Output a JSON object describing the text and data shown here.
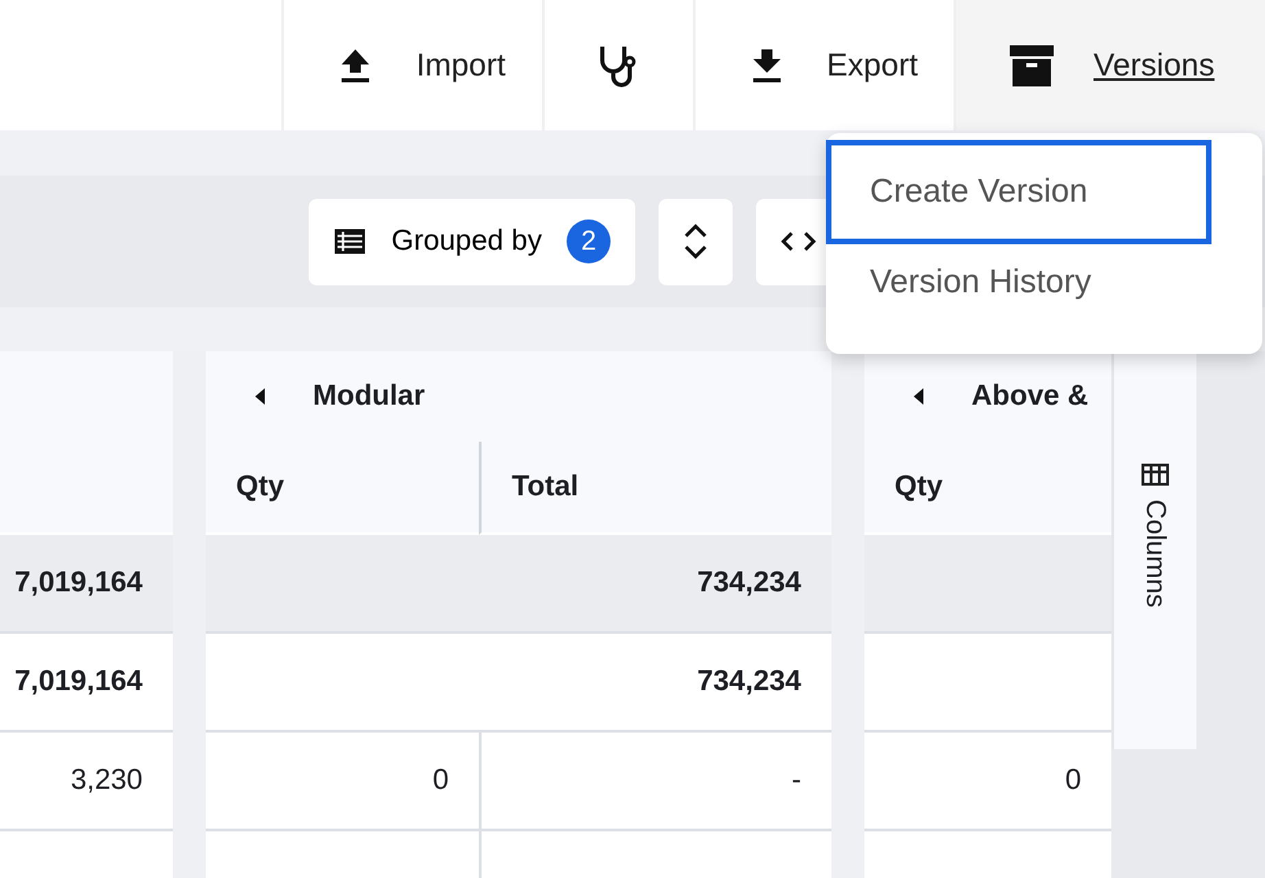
{
  "header_actions": [
    {
      "kind": "import",
      "label": "Import"
    },
    {
      "kind": "diagnose"
    },
    {
      "kind": "export",
      "label": "Export"
    },
    {
      "kind": "versions",
      "label": "Versions",
      "expanded": true
    }
  ],
  "versions_menu": [
    {
      "label": "Create Version",
      "selected": true
    },
    {
      "label": "Version History",
      "selected": false
    }
  ],
  "grid_toolbar": {
    "grouped_by": {
      "label": "Grouped by",
      "count": "2"
    }
  },
  "table": {
    "column_groups": [
      {
        "label": "Modular",
        "columns": [
          "Qty",
          "Total"
        ]
      },
      {
        "label": "Above &",
        "columns": [
          "Qty"
        ]
      }
    ],
    "rows": [
      {
        "kind": "total",
        "cells": [
          "7,019,164",
          "",
          "734,234",
          ""
        ]
      },
      {
        "kind": "subtotal",
        "cells": [
          "7,019,164",
          "",
          "734,234",
          ""
        ]
      },
      {
        "kind": "detail",
        "cells": [
          "3,230",
          "0",
          "-",
          "0"
        ]
      },
      {
        "kind": "detail"
      }
    ]
  },
  "side_panel": {
    "label": "Columns"
  }
}
